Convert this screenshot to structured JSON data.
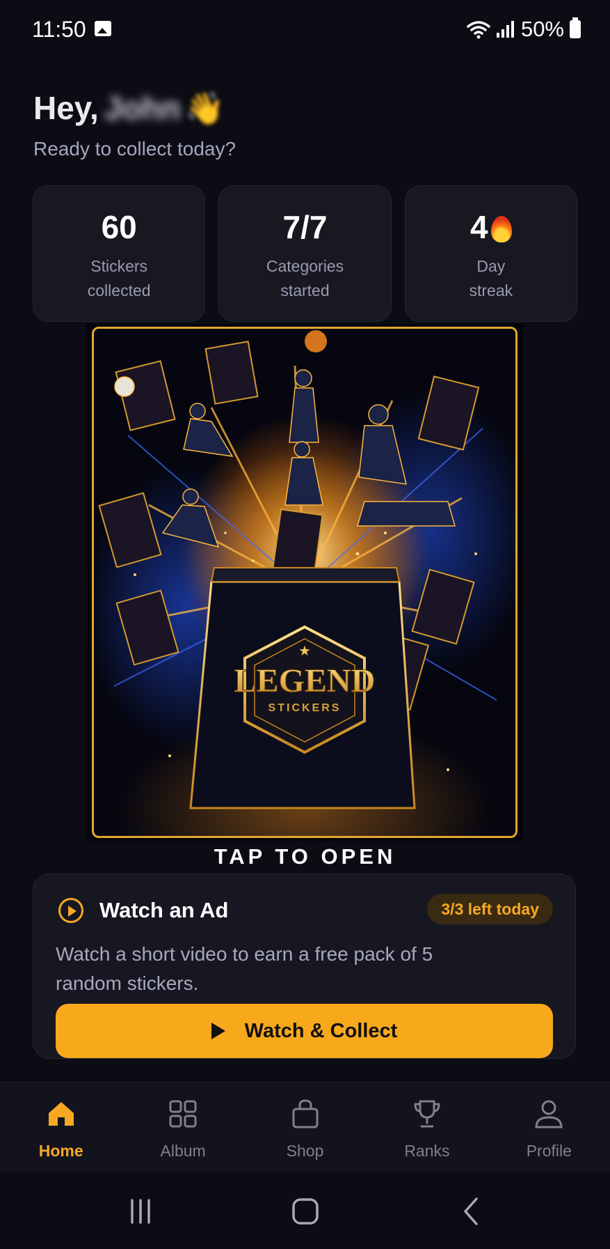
{
  "status_bar": {
    "time": "11:50",
    "battery": "50%",
    "icons": [
      "gallery-icon",
      "wifi-icon",
      "signal-icon",
      "battery-icon"
    ]
  },
  "greeting": {
    "hey": "Hey,",
    "name": "John",
    "wave": "👋",
    "subtitle": "Ready to collect today?"
  },
  "stats": [
    {
      "value": "60",
      "label_line1": "Stickers",
      "label_line2": "collected"
    },
    {
      "value": "7/7",
      "label_line1": "Categories",
      "label_line2": "started"
    },
    {
      "value": "4",
      "label_line1": "Day",
      "label_line2": "streak",
      "icon": "flame-icon"
    }
  ],
  "pack": {
    "brand": "LEGEND",
    "brand_sub": "STICKERS",
    "cta": "TAP TO OPEN"
  },
  "ad_card": {
    "title": "Watch an Ad",
    "badge": "3/3 left today",
    "description": "Watch a short video to earn a free pack of 5 random stickers.",
    "button_label": "Watch & Collect"
  },
  "nav": {
    "items": [
      {
        "label": "Home",
        "icon": "home-icon",
        "active": true
      },
      {
        "label": "Album",
        "icon": "grid-icon",
        "active": false
      },
      {
        "label": "Shop",
        "icon": "bag-icon",
        "active": false
      },
      {
        "label": "Ranks",
        "icon": "trophy-icon",
        "active": false
      },
      {
        "label": "Profile",
        "icon": "user-icon",
        "active": false
      }
    ]
  },
  "colors": {
    "background": "#0c0c14",
    "accent": "#f7a823",
    "card": "#181821"
  }
}
